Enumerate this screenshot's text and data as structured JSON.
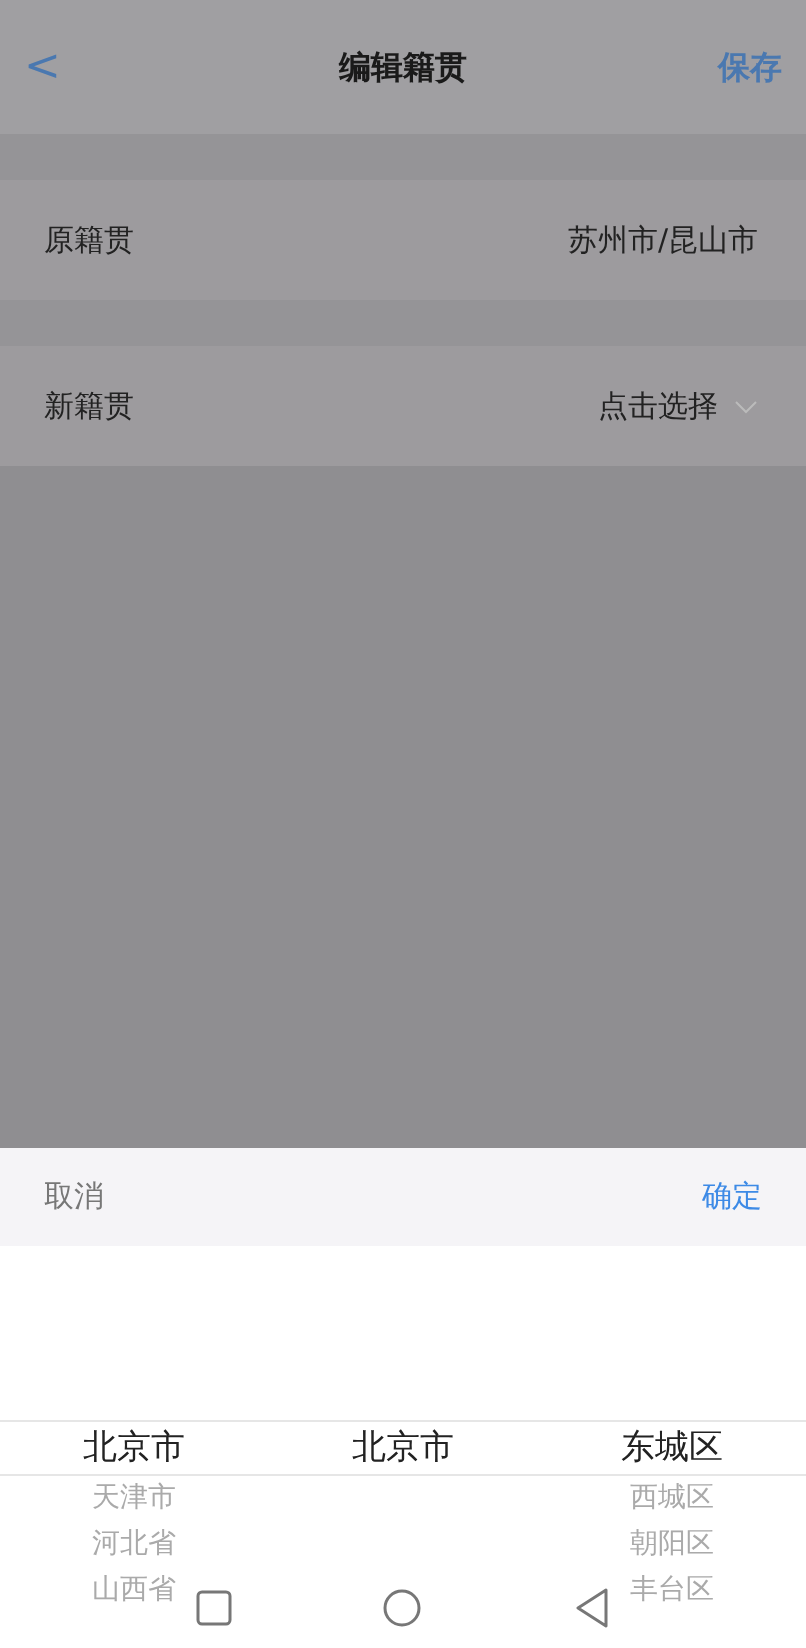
{
  "header": {
    "back": "<",
    "title": "编辑籍贯",
    "action": "保存"
  },
  "fields": [
    {
      "label": "原籍贯",
      "value": "苏州市/昆山市",
      "kind": "text"
    },
    {
      "label": "新籍贯",
      "value": "点击选择",
      "kind": "select"
    }
  ],
  "picker": {
    "cancel": "取消",
    "confirm": "确定",
    "columns": [
      [
        {
          "label": "北京市",
          "selected": true
        },
        {
          "label": "天津市",
          "selected": false
        },
        {
          "label": "河北省",
          "selected": false
        },
        {
          "label": "山西省",
          "selected": false
        }
      ],
      [
        {
          "label": "北京市",
          "selected": true
        }
      ],
      [
        {
          "label": "东城区",
          "selected": true
        },
        {
          "label": "西城区",
          "selected": false
        },
        {
          "label": "朝阳区",
          "selected": false
        },
        {
          "label": "丰台区",
          "selected": false
        }
      ]
    ]
  }
}
